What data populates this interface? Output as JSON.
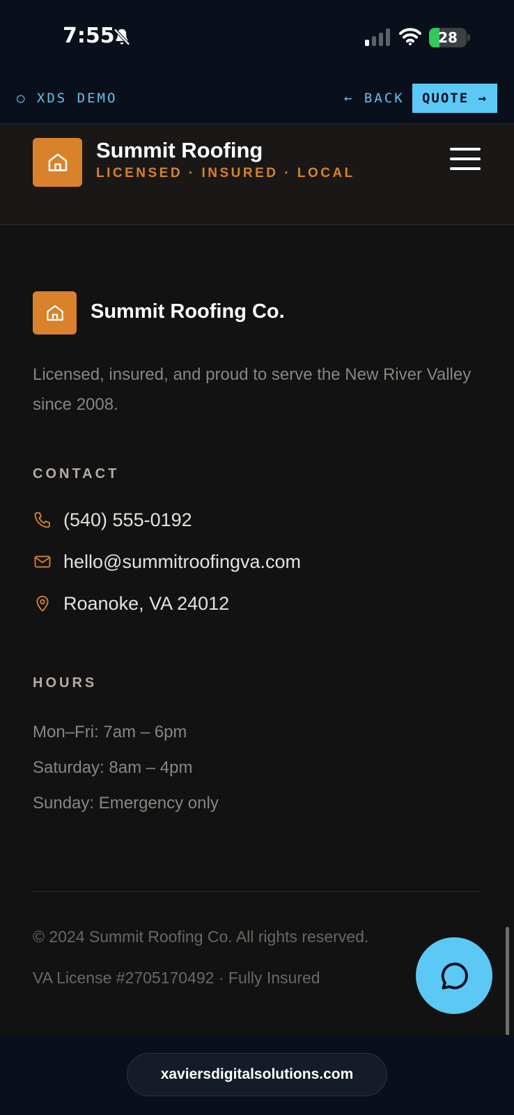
{
  "status_bar": {
    "time": "7:55",
    "battery": "28",
    "battery_level_percent": 28
  },
  "demo_bar": {
    "label": "○ XDS DEMO",
    "back": "← BACK",
    "quote": "QUOTE →"
  },
  "header": {
    "brand_name": "Summit Roofing",
    "tagline": "LICENSED · INSURED · LOCAL"
  },
  "footer": {
    "brand_name": "Summit Roofing Co.",
    "description": "Licensed, insured, and proud to serve the New River Valley since 2008.",
    "contact_heading": "CONTACT",
    "phone": "(540) 555-0192",
    "email": "hello@summitroofingva.com",
    "location": "Roanoke, VA 24012",
    "hours_heading": "HOURS",
    "hours": [
      "Mon–Fri: 7am – 6pm",
      "Saturday: 8am – 4pm",
      "Sunday: Emergency only"
    ],
    "copyright": "© 2024 Summit Roofing Co. All rights reserved.",
    "license": "VA License #2705170492 · Fully Insured"
  },
  "browser": {
    "url": "xaviersdigitalsolutions.com"
  },
  "colors": {
    "accent_orange": "#d9822b",
    "accent_blue": "#5bc8f5",
    "background": "#121212",
    "header_bg": "#1a1816"
  },
  "icons": [
    "bell-slash-icon",
    "signal-icon",
    "wifi-icon",
    "battery-icon",
    "house-icon",
    "menu-icon",
    "phone-icon",
    "mail-icon",
    "map-pin-icon",
    "chat-icon"
  ]
}
